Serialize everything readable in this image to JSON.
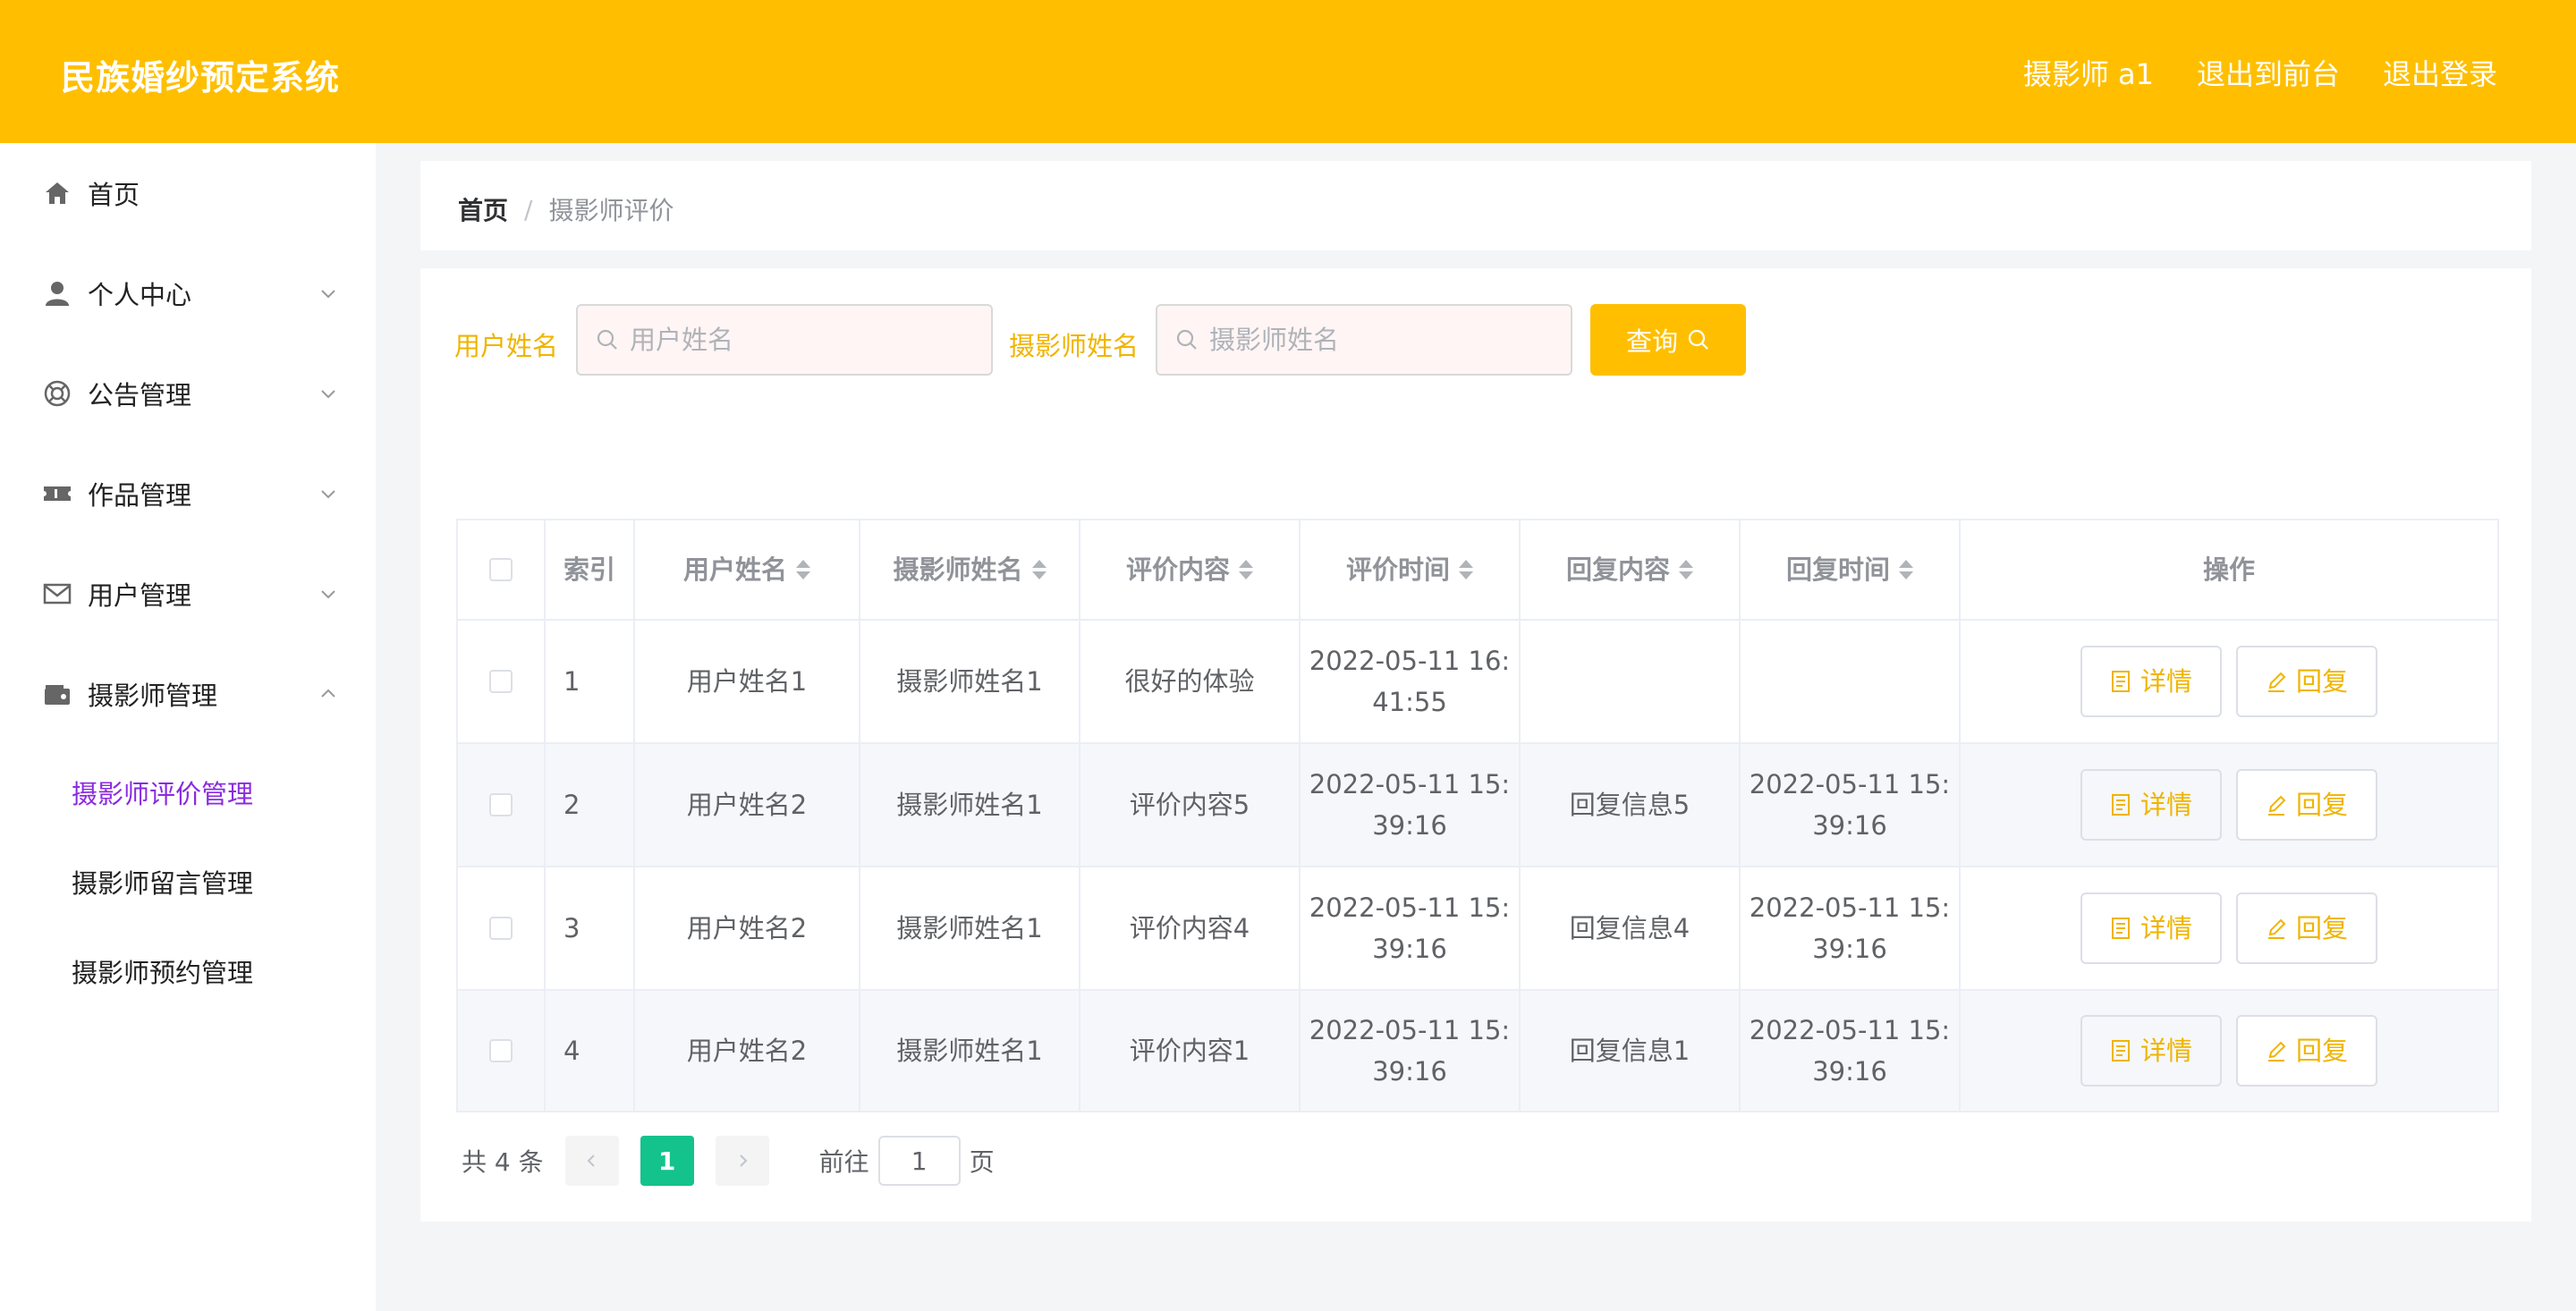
{
  "header": {
    "brand": "民族婚纱预定系统",
    "user": "摄影师 a1",
    "front_link": "退出到前台",
    "logout": "退出登录"
  },
  "sidebar": {
    "items": [
      {
        "label": "首页",
        "icon": "home-icon"
      },
      {
        "label": "个人中心",
        "icon": "user-icon"
      },
      {
        "label": "公告管理",
        "icon": "lifebuoy-icon"
      },
      {
        "label": "作品管理",
        "icon": "ticket-icon"
      },
      {
        "label": "用户管理",
        "icon": "mail-icon"
      },
      {
        "label": "摄影师管理",
        "icon": "wallet-icon"
      }
    ],
    "sub_items": [
      {
        "label": "摄影师评价管理",
        "active": true
      },
      {
        "label": "摄影师留言管理",
        "active": false
      },
      {
        "label": "摄影师预约管理",
        "active": false
      }
    ]
  },
  "breadcrumb": {
    "home": "首页",
    "separator": "/",
    "current": "摄影师评价"
  },
  "search": {
    "user_label": "用户姓名",
    "user_placeholder": "用户姓名",
    "photographer_label": "摄影师姓名",
    "photographer_placeholder": "摄影师姓名",
    "query_label": "查询"
  },
  "table": {
    "headers": [
      "索引",
      "用户姓名",
      "摄影师姓名",
      "评价内容",
      "评价时间",
      "回复内容",
      "回复时间",
      "操作"
    ],
    "rows": [
      {
        "index": "1",
        "user": "用户姓名1",
        "photographer": "摄影师姓名1",
        "content": "很好的体验",
        "time_a": "2022-05-11 16:",
        "time_b": "41:55",
        "reply": "",
        "reply_time_a": "",
        "reply_time_b": ""
      },
      {
        "index": "2",
        "user": "用户姓名2",
        "photographer": "摄影师姓名1",
        "content": "评价内容5",
        "time_a": "2022-05-11 15:",
        "time_b": "39:16",
        "reply": "回复信息5",
        "reply_time_a": "2022-05-11 15:",
        "reply_time_b": "39:16"
      },
      {
        "index": "3",
        "user": "用户姓名2",
        "photographer": "摄影师姓名1",
        "content": "评价内容4",
        "time_a": "2022-05-11 15:",
        "time_b": "39:16",
        "reply": "回复信息4",
        "reply_time_a": "2022-05-11 15:",
        "reply_time_b": "39:16"
      },
      {
        "index": "4",
        "user": "用户姓名2",
        "photographer": "摄影师姓名1",
        "content": "评价内容1",
        "time_a": "2022-05-11 15:",
        "time_b": "39:16",
        "reply": "回复信息1",
        "reply_time_a": "2022-05-11 15:",
        "reply_time_b": "39:16"
      }
    ],
    "detail_label": "详情",
    "reply_label": "回复"
  },
  "pagination": {
    "total": "共 4 条",
    "current_page": "1",
    "goto_label": "前往",
    "goto_value": "1",
    "page_unit": "页"
  },
  "colors": {
    "accent": "#ffbf00",
    "active_menu": "#8a2be2",
    "page_active": "#13c38b"
  }
}
